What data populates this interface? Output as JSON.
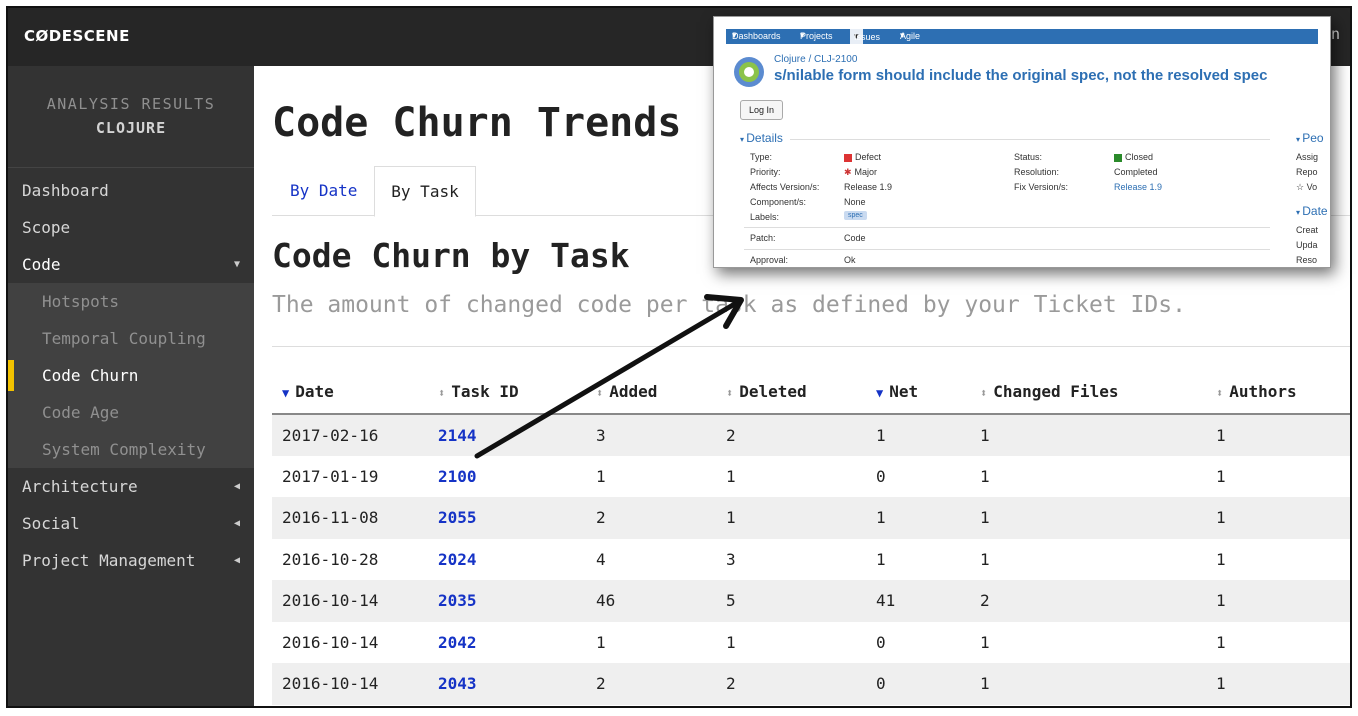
{
  "app": {
    "logo": "CØDESCENE",
    "topbar_right": "n"
  },
  "sidebar": {
    "header_line1": "ANALYSIS RESULTS",
    "header_line2": "CLOJURE",
    "items": [
      {
        "label": "Dashboard"
      },
      {
        "label": "Scope"
      },
      {
        "label": "Code"
      },
      {
        "label": "Architecture"
      },
      {
        "label": "Social"
      },
      {
        "label": "Project Management"
      }
    ],
    "code_subitems": [
      {
        "label": "Hotspots"
      },
      {
        "label": "Temporal Coupling"
      },
      {
        "label": "Code Churn"
      },
      {
        "label": "Code Age"
      },
      {
        "label": "System Complexity"
      }
    ]
  },
  "main": {
    "page_title": "Code Churn Trends",
    "tabs": [
      {
        "label": "By Date"
      },
      {
        "label": "By Task"
      }
    ],
    "section_title": "Code Churn by Task",
    "subtitle": "The amount of changed code per task as defined by your Ticket IDs."
  },
  "table": {
    "headers": [
      "Date",
      "Task ID",
      "Added",
      "Deleted",
      "Net",
      "Changed Files",
      "Authors"
    ],
    "rows": [
      [
        "2017-02-16",
        "2144",
        "3",
        "2",
        "1",
        "1",
        "1"
      ],
      [
        "2017-01-19",
        "2100",
        "1",
        "1",
        "0",
        "1",
        "1"
      ],
      [
        "2016-11-08",
        "2055",
        "2",
        "1",
        "1",
        "1",
        "1"
      ],
      [
        "2016-10-28",
        "2024",
        "4",
        "3",
        "1",
        "1",
        "1"
      ],
      [
        "2016-10-14",
        "2035",
        "46",
        "5",
        "41",
        "2",
        "1"
      ],
      [
        "2016-10-14",
        "2042",
        "1",
        "1",
        "0",
        "1",
        "1"
      ],
      [
        "2016-10-14",
        "2043",
        "2",
        "2",
        "0",
        "1",
        "1"
      ]
    ]
  },
  "overlay": {
    "nav": [
      "Dashboards",
      "Projects",
      "Issues",
      "Agile"
    ],
    "breadcrumb": "Clojure / CLJ-2100",
    "title": "s/nilable form should include the original spec, not the resolved spec",
    "login": "Log In",
    "details_label": "Details",
    "people_label": "Peo",
    "dates_label": "Date",
    "fields": {
      "type_label": "Type:",
      "type_value": "Defect",
      "priority_label": "Priority:",
      "priority_value": "Major",
      "affects_label": "Affects Version/s:",
      "affects_value": "Release 1.9",
      "component_label": "Component/s:",
      "component_value": "None",
      "labels_label": "Labels:",
      "labels_value": "spec",
      "patch_label": "Patch:",
      "patch_value": "Code",
      "approval_label": "Approval:",
      "approval_value": "Ok",
      "status_label": "Status:",
      "status_value": "Closed",
      "resolution_label": "Resolution:",
      "resolution_value": "Completed",
      "fixversion_label": "Fix Version/s:",
      "fixversion_value": "Release 1.9"
    },
    "people_fields": [
      "Assig",
      "Repo",
      "Vo"
    ],
    "date_fields": [
      "Creat",
      "Upda",
      "Reso"
    ]
  },
  "colors": {
    "accent": "#f2c200",
    "link": "#1533c6",
    "sidebar": "#333333",
    "topbar": "#262626",
    "jira_blue": "#2d6fb3"
  }
}
